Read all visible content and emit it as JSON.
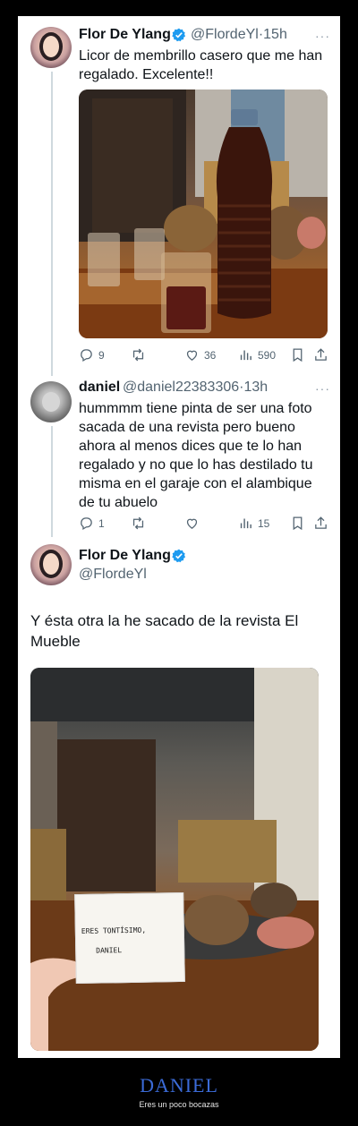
{
  "tweets": [
    {
      "name": "Flor De Ylang",
      "handle": "@FlordeYl",
      "time": "15h",
      "text_lines": [
        "Licor de membrillo casero que me han",
        "regalado. Excelente!!"
      ],
      "stats": {
        "replies": "9",
        "likes": "36",
        "views": "590"
      }
    },
    {
      "name": "daniel",
      "handle": "@daniel22383306",
      "time": "13h",
      "text_lines": [
        "hummmm tiene pinta de ser una foto",
        "sacada de una revista pero bueno",
        "ahora al menos dices que te lo han",
        "regalado y no que lo has destilado tu",
        "misma en el garaje con el alambique",
        "de tu abuelo"
      ],
      "stats": {
        "replies": "1",
        "views": "15"
      }
    },
    {
      "name": "Flor De Ylang",
      "handle": "@FlordeYl",
      "text_lines": [
        "Y ésta otra la he sacado de la revista El",
        "Mueble"
      ],
      "note_lines": [
        "ERES TONTÍSIMO,",
        "DANIEL"
      ]
    }
  ],
  "more_glyph": "···",
  "footer": {
    "title": "DANIEL",
    "subtitle": "Eres un poco bocazas"
  },
  "colors": {
    "verified": "#1d9bf0",
    "footer_title": "#3b6bd8"
  }
}
